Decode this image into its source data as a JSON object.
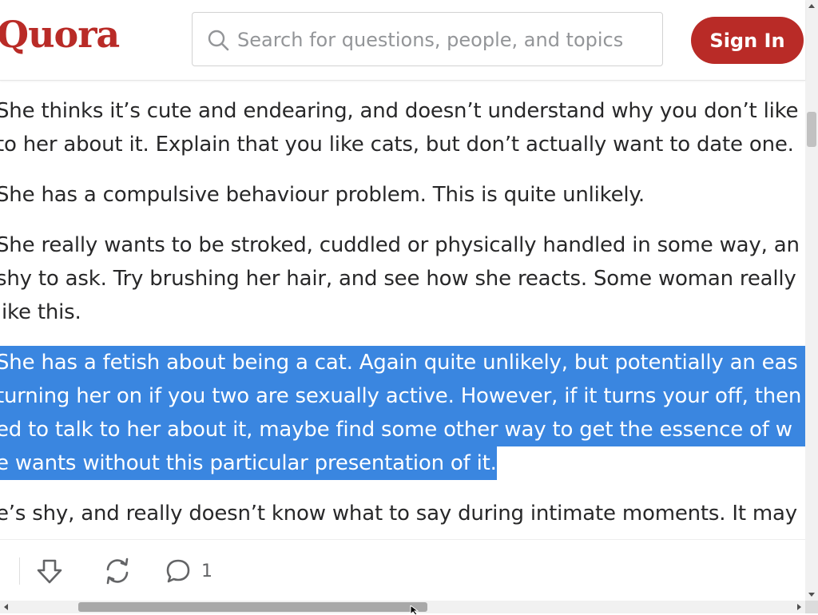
{
  "header": {
    "logo": "Quora",
    "search_placeholder": "Search for questions, people, and topics",
    "sign_in_label": "Sign In"
  },
  "content": {
    "paragraphs": [
      {
        "lines": [
          "She thinks it’s cute and endearing, and doesn’t understand why you don’t like",
          "to her about it. Explain that you like cats, but don’t actually want to date one."
        ],
        "highlighted": false
      },
      {
        "lines": [
          "She has a compulsive behaviour problem. This is quite unlikely."
        ],
        "highlighted": false
      },
      {
        "lines": [
          "She really wants to be stroked, cuddled or physically handled in some way, an",
          "shy to ask. Try brushing her hair, and see how she reacts. Some woman really",
          "like this."
        ],
        "highlighted": false
      },
      {
        "lines": [
          "She has a fetish about being a cat. Again quite unlikely, but potentially an eas",
          "turning her on if you two are sexually active. However, if it turns your off, then yo",
          "ed to talk to her about it, maybe find some other way to get the essence of w",
          "e wants without this particular presentation of it."
        ],
        "highlighted": true
      },
      {
        "lines": [
          "e’s shy, and really doesn’t know what to say during intimate moments. It may"
        ],
        "highlighted": false
      }
    ]
  },
  "actions": {
    "downvote_icon": "downvote-arrow-icon",
    "share_icon": "share-cycle-icon",
    "comment_icon": "comment-bubble-icon",
    "comment_count": "1"
  },
  "colors": {
    "brand": "#b92b27",
    "highlight": "#3a86e0",
    "text": "#282829"
  }
}
